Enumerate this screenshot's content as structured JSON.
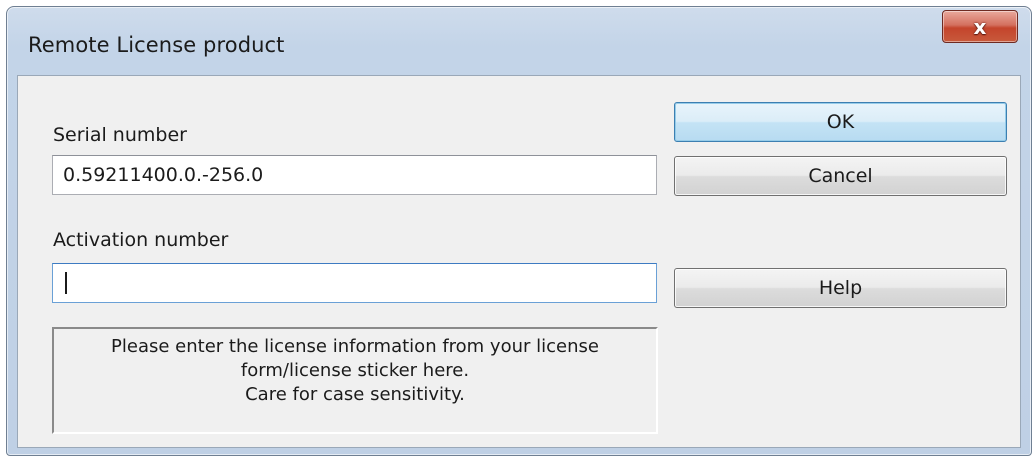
{
  "window": {
    "title": "Remote License product",
    "close_glyph": "x",
    "close_icon": "close-icon"
  },
  "form": {
    "serial_label": "Serial number",
    "serial_value": "0.59211400.0.-256.0",
    "activation_label": "Activation number",
    "activation_value": ""
  },
  "buttons": {
    "ok": "OK",
    "cancel": "Cancel",
    "help": "Help"
  },
  "info": {
    "lines": [
      "Please enter the license information from your license",
      "form/license sticker here.",
      "Care for case sensitivity."
    ]
  },
  "colors": {
    "titlebar": "#c3d4e8",
    "client": "#f0f0f0",
    "close_button": "#c4442c",
    "focus_border": "#3d7bc2"
  }
}
